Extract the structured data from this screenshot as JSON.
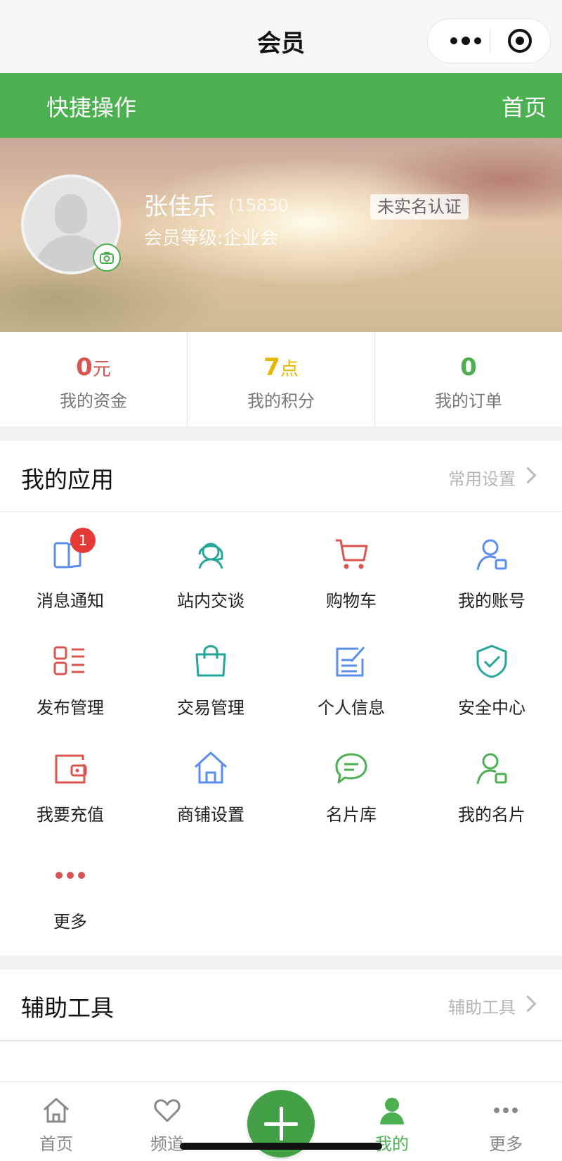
{
  "titlebar": {
    "title": "会员"
  },
  "quickbar": {
    "left_label": "快捷操作",
    "right_label": "首页"
  },
  "profile": {
    "name": "张佳乐",
    "phone": "(15830",
    "verify_label": "未实名认证",
    "level": "会员等级:企业会"
  },
  "stats": [
    {
      "value": "0",
      "unit": "元",
      "label": "我的资金",
      "color": "#d9534f"
    },
    {
      "value": "7",
      "unit": "点",
      "label": "我的积分",
      "color": "#e6b800"
    },
    {
      "value": "0",
      "unit": "",
      "label": "我的订单",
      "color": "#4caf50"
    }
  ],
  "apps_section": {
    "title": "我的应用",
    "link": "常用设置"
  },
  "apps": [
    {
      "label": "消息通知",
      "icon": "message-notify-icon",
      "color": "#5b8def",
      "badge": "1"
    },
    {
      "label": "站内交谈",
      "icon": "chat-agent-icon",
      "color": "#26a69a"
    },
    {
      "label": "购物车",
      "icon": "shopping-cart-icon",
      "color": "#d9534f"
    },
    {
      "label": "我的账号",
      "icon": "user-account-icon",
      "color": "#5b8def"
    },
    {
      "label": "发布管理",
      "icon": "list-manage-icon",
      "color": "#d9534f"
    },
    {
      "label": "交易管理",
      "icon": "shopping-bag-icon",
      "color": "#26a69a"
    },
    {
      "label": "个人信息",
      "icon": "edit-form-icon",
      "color": "#5b8def"
    },
    {
      "label": "安全中心",
      "icon": "shield-check-icon",
      "color": "#26a69a"
    },
    {
      "label": "我要充值",
      "icon": "wallet-icon",
      "color": "#d9534f"
    },
    {
      "label": "商铺设置",
      "icon": "store-home-icon",
      "color": "#5b8def"
    },
    {
      "label": "名片库",
      "icon": "comment-bubble-icon",
      "color": "#4caf50"
    },
    {
      "label": "我的名片",
      "icon": "user-card-icon",
      "color": "#4caf50"
    },
    {
      "label": "更多",
      "icon": "more-dots-icon",
      "color": "#d9534f"
    }
  ],
  "tools_section": {
    "title": "辅助工具",
    "link": "辅助工具"
  },
  "tabbar": [
    {
      "label": "首页",
      "icon": "home-icon",
      "active": false
    },
    {
      "label": "频道",
      "icon": "heart-icon",
      "active": false
    },
    {
      "label": "",
      "icon": "plus-icon",
      "active": false
    },
    {
      "label": "我的",
      "icon": "user-icon",
      "active": true
    },
    {
      "label": "更多",
      "icon": "more-icon",
      "active": false
    }
  ]
}
